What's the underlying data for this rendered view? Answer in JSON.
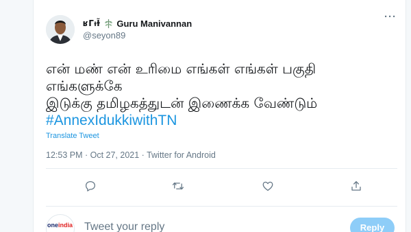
{
  "tweet": {
    "author": {
      "name_prefix": "ʁΓᵼƗ̃",
      "display_name": "Guru Manivannan",
      "handle": "@seyon89",
      "name_icon": "sparkle-leaf-icon"
    },
    "more_icon": "more-options-icon",
    "more_label": "···",
    "text_lines": [
      "என் மண் என் உரிமை எங்கள்  எங்கள் பகுதி",
      "எங்களுக்கே",
      "இடுக்கு தமிழகத்துடன் இணைக்க வேண்டும்"
    ],
    "hashtag": "#AnnexIdukkiwithTN",
    "translate_label": "Translate Tweet",
    "meta": "12:53 PM · Oct 27, 2021 · Twitter for Android",
    "actions": {
      "reply_icon": "reply-icon",
      "retweet_icon": "retweet-icon",
      "like_icon": "like-icon",
      "share_icon": "share-icon"
    }
  },
  "composer": {
    "avatar_logo_part1": "one",
    "avatar_logo_part2": "india",
    "placeholder": "Tweet your reply",
    "reply_button": "Reply"
  },
  "colors": {
    "accent": "#1b95e0",
    "muted": "#657786",
    "reply_button": "#8ecdf8"
  }
}
